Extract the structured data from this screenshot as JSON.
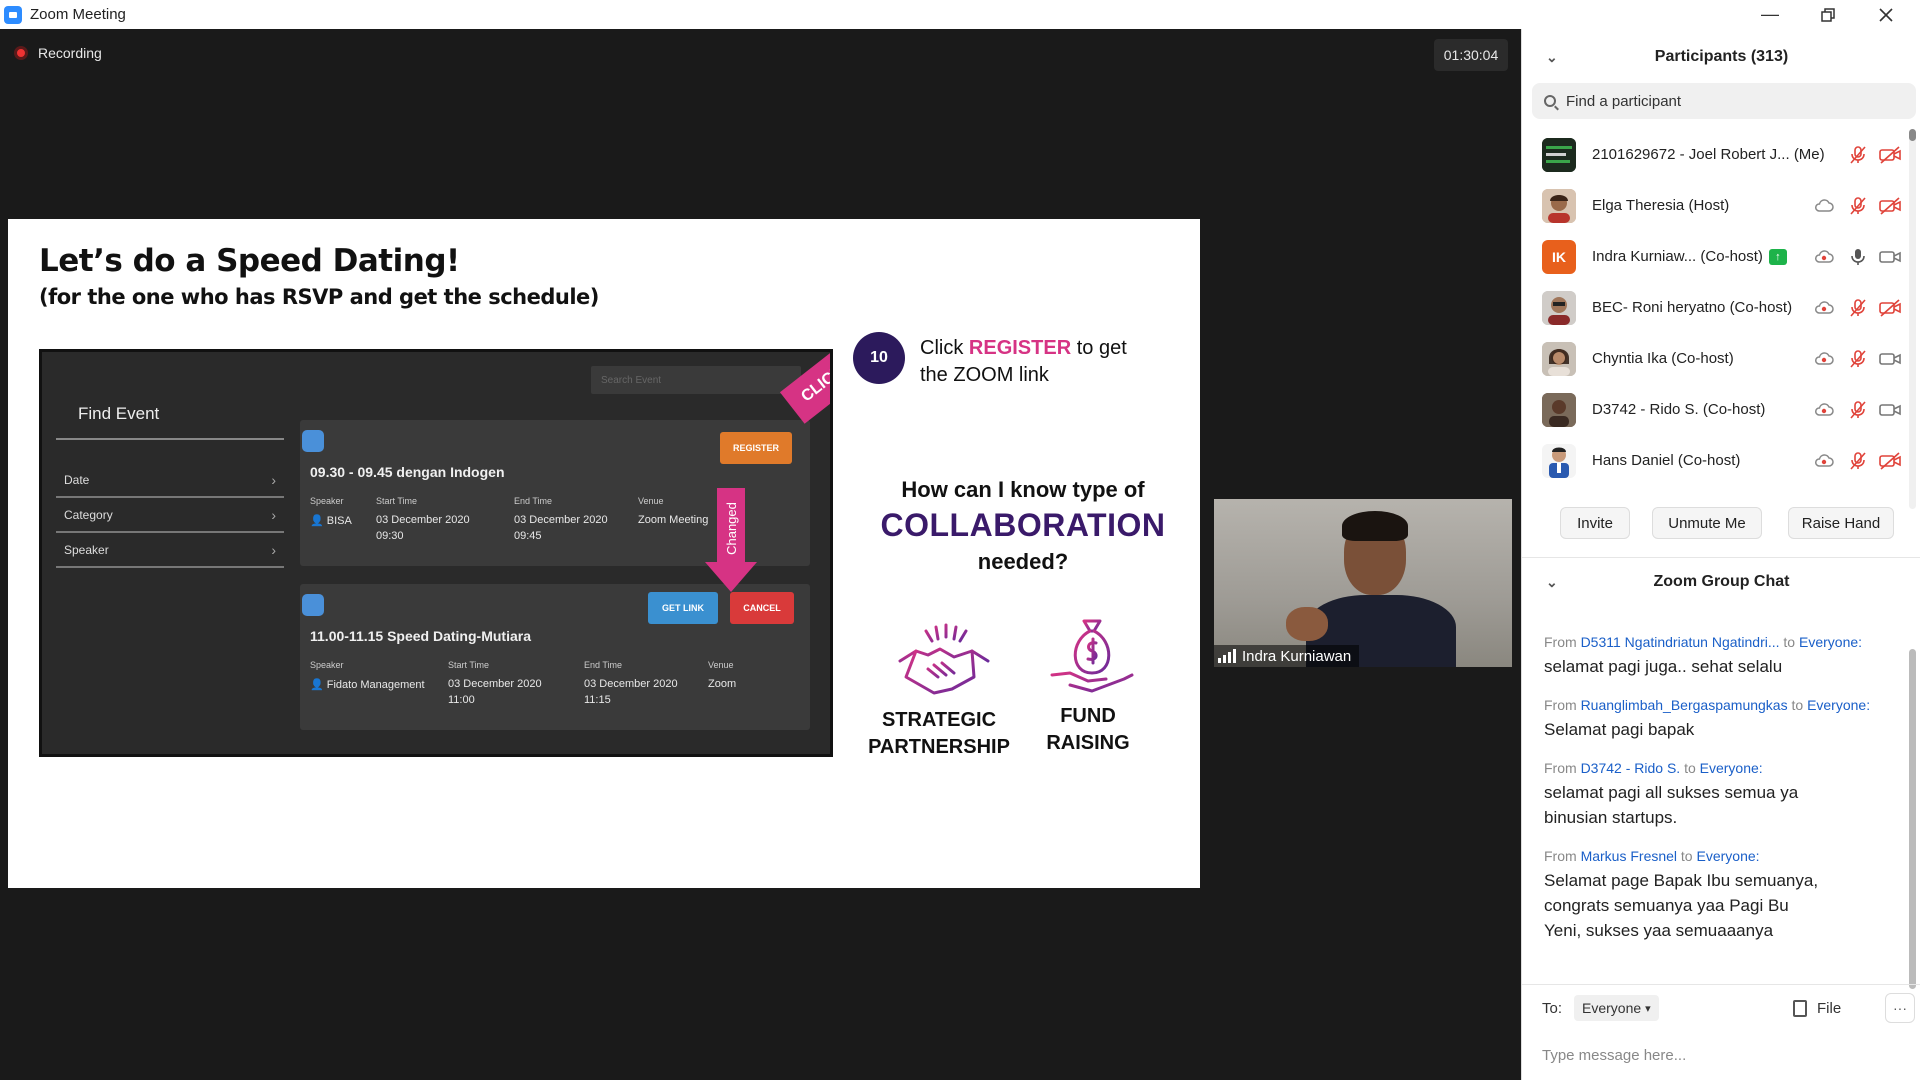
{
  "window": {
    "title": "Zoom Meeting",
    "icon": "zoom-camera-icon",
    "controls": [
      "minimize-icon",
      "restore-icon",
      "close-icon"
    ]
  },
  "meeting": {
    "recording_label": "Recording",
    "timer": "01:30:04",
    "video": {
      "name": "Indra Kurniawan"
    }
  },
  "slide": {
    "title": "Let’s do a Speed Dating!",
    "subtitle": "(for the one who has RSVP and get the schedule)",
    "mock": {
      "heading": "Find Event",
      "search_placeholder": "Search Event",
      "filters": [
        "Date",
        "Category",
        "Speaker"
      ],
      "cards": [
        {
          "title": "09.30 - 09.45 dengan Indogen",
          "speaker_label": "Speaker",
          "speaker": "BISA",
          "start_label": "Start Time",
          "start_date": "03 December 2020",
          "start_time": "09:30",
          "end_label": "End Time",
          "end_date": "03 December 2020",
          "end_time": "09:45",
          "venue_label": "Venue",
          "venue": "Zoom Meeting",
          "button": "REGISTER"
        },
        {
          "title": "11.00-11.15 Speed Dating-Mutiara",
          "speaker_label": "Speaker",
          "speaker": "Fidato Management",
          "start_label": "Start Time",
          "start_date": "03 December 2020",
          "start_time": "11:00",
          "end_label": "End Time",
          "end_date": "03 December 2020",
          "end_time": "11:15",
          "venue_label": "Venue",
          "venue": "Zoom",
          "button_link": "GET LINK",
          "button_cancel": "CANCEL"
        }
      ],
      "click_tag": "CLICK",
      "changed_tag": "Changed"
    },
    "step_number": "10",
    "step_pre": "Click",
    "step_highlight": "REGISTER",
    "step_post": "to get the ZOOM link",
    "question_line1": "How can I know type of",
    "question_line2": "COLLABORATION",
    "question_line3": "needed?",
    "categories": [
      {
        "label": "STRATEGIC PARTNERSHIP",
        "icon": "handshake-icon"
      },
      {
        "label": "FUND RAISING",
        "icon": "money-bag-hand-icon"
      }
    ]
  },
  "participants": {
    "header": "Participants (313)",
    "search_placeholder": "Find a participant",
    "list": [
      {
        "name": "2101629672 - Joel Robert J...",
        "tag": "(Me)",
        "muted": true,
        "video_off": true
      },
      {
        "name": "Elga Theresia (Host)",
        "muted": true,
        "video_off": true
      },
      {
        "name": "Indra Kurniaw...",
        "tag": "(Co-host)",
        "initials": "IK",
        "muted": false,
        "video_off": false
      },
      {
        "name": "BEC- Roni heryatno (Co-host)",
        "muted": true,
        "video_off": true
      },
      {
        "name": "Chyntia Ika (Co-host)",
        "muted": true,
        "video_off": false
      },
      {
        "name": "D3742 - Rido S. (Co-host)",
        "muted": true,
        "video_off": false
      },
      {
        "name": "Hans Daniel (Co-host)",
        "muted": true,
        "video_off": true
      }
    ],
    "buttons": {
      "invite": "Invite",
      "unmute": "Unmute Me",
      "raise": "Raise Hand"
    }
  },
  "chat": {
    "header": "Zoom Group Chat",
    "messages": [
      {
        "from_prefix": "From",
        "from": "D5311 Ngatindriatun Ngatindri...",
        "to_prefix": "to",
        "to": "Everyone:",
        "text": "selamat pagi juga.. sehat selalu"
      },
      {
        "from_prefix": "From",
        "from": "Ruanglimbah_Bergaspamungkas",
        "to_prefix": "to",
        "to": "Everyone:",
        "text": "Selamat pagi bapak"
      },
      {
        "from_prefix": "From",
        "from": "D3742 - Rido S.",
        "to_prefix": "to",
        "to": "Everyone:",
        "text": "selamat pagi all sukses semua ya binusian startups."
      },
      {
        "from_prefix": "From",
        "from": "Markus Fresnel",
        "to_prefix": "to",
        "to": "Everyone:",
        "text": "Selamat page Bapak Ibu semuanya, congrats semuanya yaa Pagi Bu Yeni, sukses yaa semuaaanya"
      }
    ],
    "to_label": "To:",
    "to_value": "Everyone",
    "file_label": "File",
    "more_label": "···",
    "input_placeholder": "Type message here..."
  },
  "colors": {
    "accent": "#2D8CFF",
    "highlight": "#d63384",
    "collab": "#3a1a6a",
    "muted_red": "#e0433a",
    "chat_link": "#1a5fc8"
  }
}
